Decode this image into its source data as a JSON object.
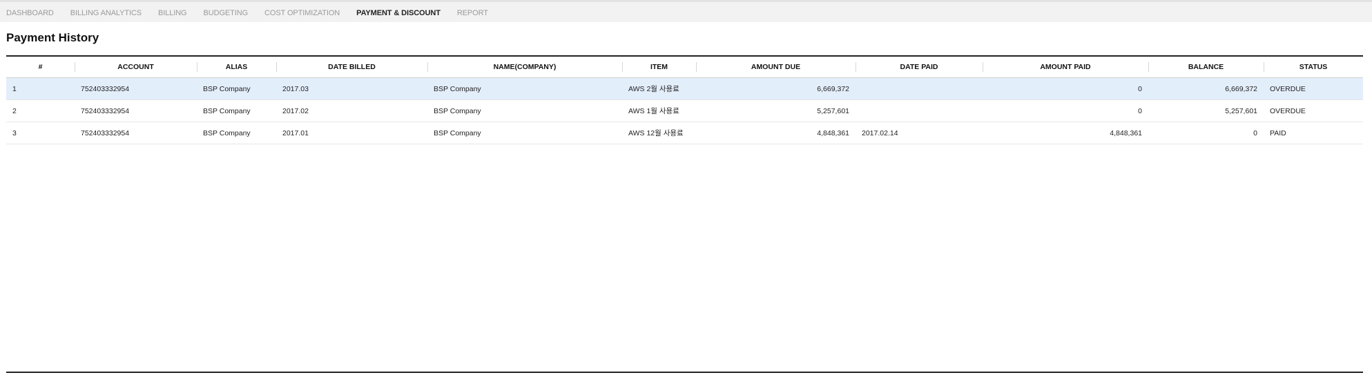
{
  "nav": {
    "items": [
      {
        "label": "DASHBOARD",
        "active": false
      },
      {
        "label": "BILLING ANALYTICS",
        "active": false
      },
      {
        "label": "BILLING",
        "active": false
      },
      {
        "label": "BUDGETING",
        "active": false
      },
      {
        "label": "COST OPTIMIZATION",
        "active": false
      },
      {
        "label": "PAYMENT & DISCOUNT",
        "active": true
      },
      {
        "label": "REPORT",
        "active": false
      }
    ]
  },
  "page": {
    "title": "Payment History"
  },
  "table": {
    "headers": [
      "#",
      "ACCOUNT",
      "ALIAS",
      "DATE BILLED",
      "NAME(COMPANY)",
      "ITEM",
      "AMOUNT DUE",
      "DATE PAID",
      "AMOUNT PAID",
      "BALANCE",
      "STATUS"
    ],
    "rows": [
      {
        "no": "1",
        "account": "752403332954",
        "alias": "BSP Company",
        "date_billed": "2017.03",
        "name": "BSP Company",
        "item": "AWS 2월 사용료",
        "amount_due": "6,669,372",
        "date_paid": "",
        "amount_paid": "0",
        "balance": "6,669,372",
        "status": "OVERDUE",
        "selected": true
      },
      {
        "no": "2",
        "account": "752403332954",
        "alias": "BSP Company",
        "date_billed": "2017.02",
        "name": "BSP Company",
        "item": "AWS 1월 사용료",
        "amount_due": "5,257,601",
        "date_paid": "",
        "amount_paid": "0",
        "balance": "5,257,601",
        "status": "OVERDUE",
        "selected": false
      },
      {
        "no": "3",
        "account": "752403332954",
        "alias": "BSP Company",
        "date_billed": "2017.01",
        "name": "BSP Company",
        "item": "AWS 12월 사용료",
        "amount_due": "4,848,361",
        "date_paid": "2017.02.14",
        "amount_paid": "4,848,361",
        "balance": "0",
        "status": "PAID",
        "selected": false
      }
    ]
  },
  "colors": {
    "selected_row": "#e3eefb",
    "active_nav": "#222222",
    "inactive_nav": "#9a9a9a"
  }
}
